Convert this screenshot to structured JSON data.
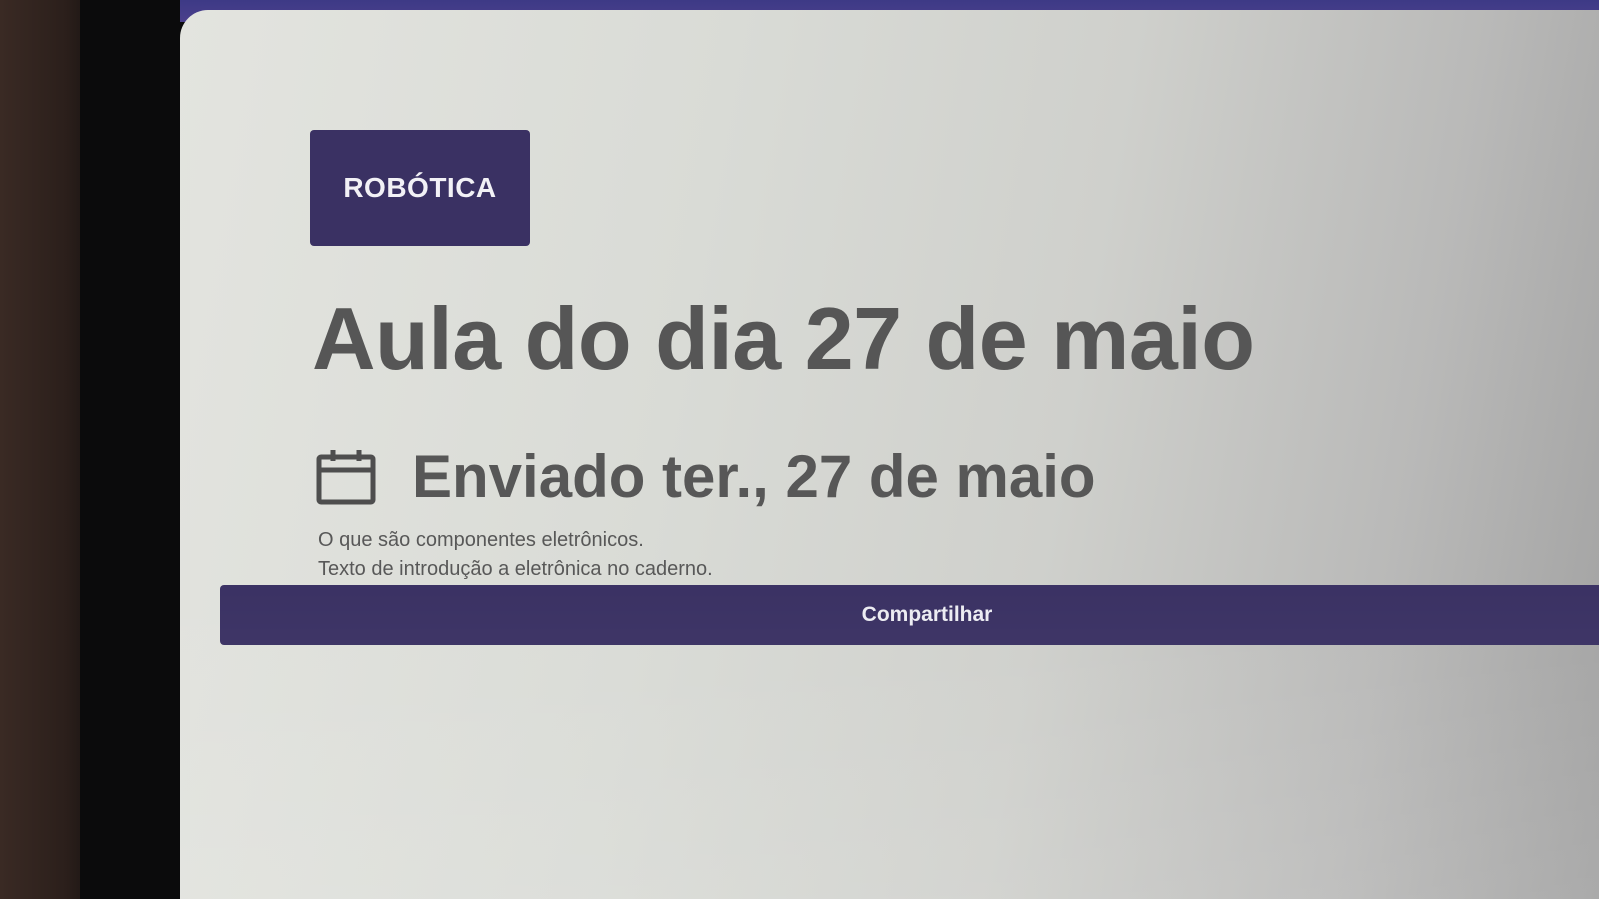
{
  "post": {
    "course_label": "ROBÓTICA",
    "title": "Aula do dia 27 de maio",
    "sent_date": "Enviado ter., 27 de maio",
    "description_lines": [
      "O que são componentes eletrônicos.",
      "Texto de introdução a eletrônica no caderno."
    ]
  },
  "actions": {
    "share_label": "Compartilhar"
  },
  "icons": {
    "date": "calendar-icon"
  },
  "colors": {
    "accent": "#3a3163",
    "header_bar": "#433c88",
    "text": "#565656"
  }
}
